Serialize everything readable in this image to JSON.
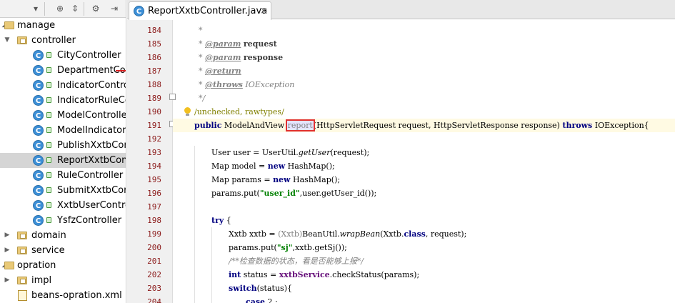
{
  "sidebar": {
    "tree": [
      {
        "label": "manage",
        "kind": "folder",
        "expanded": true
      },
      {
        "label": "controller",
        "kind": "package",
        "expanded": true
      },
      {
        "label": "CityController",
        "kind": "class"
      },
      {
        "label": "DepartmentCont",
        "kind": "class"
      },
      {
        "label": "IndicatorControl",
        "kind": "class"
      },
      {
        "label": "IndicatorRuleCor",
        "kind": "class"
      },
      {
        "label": "ModelController",
        "kind": "class"
      },
      {
        "label": "ModelIndicatorC",
        "kind": "class"
      },
      {
        "label": "PublishXxtbContr",
        "kind": "class"
      },
      {
        "label": "ReportXxtbContr",
        "kind": "class",
        "selected": true
      },
      {
        "label": "RuleController",
        "kind": "class"
      },
      {
        "label": "SubmitXxtbContr",
        "kind": "class"
      },
      {
        "label": "XxtbUserControl",
        "kind": "class"
      },
      {
        "label": "YsfzController",
        "kind": "class"
      },
      {
        "label": "domain",
        "kind": "package",
        "expanded": false
      },
      {
        "label": "service",
        "kind": "package",
        "expanded": false
      },
      {
        "label": "opration",
        "kind": "folder",
        "expanded": true
      },
      {
        "label": "impl",
        "kind": "package",
        "expanded": false
      },
      {
        "label": "beans-opration.xml",
        "kind": "xml"
      }
    ]
  },
  "editor": {
    "tab_title": "ReportXxtbController.java",
    "tab_icon_letter": "C",
    "line_numbers": [
      "184",
      "185",
      "186",
      "187",
      "188",
      "189",
      "190",
      "191",
      "192",
      "193",
      "194",
      "195",
      "196",
      "197",
      "198",
      "199",
      "200",
      "201",
      "202",
      "203",
      "204"
    ],
    "tokens": {
      "l184_star": "*",
      "l185_star": "* ",
      "l185_tag": "@param",
      "l185_name": "request",
      "l186_star": "* ",
      "l186_tag": "@param",
      "l186_name": "response",
      "l187_star": "* ",
      "l187_tag": "@return",
      "l188_star": "* ",
      "l188_tag": "@throws",
      "l188_text": " IOException",
      "l189_end": "*/",
      "l190_ann": "/unchecked, rawtypes/",
      "l191_kw1": "public",
      "l191_a": " ModelAndView ",
      "l191_method": "report",
      "l191_b": "(HttpServletRequest request, HttpServletResponse response) ",
      "l191_kw2": "throws",
      "l191_c": " IOException{",
      "l193_a": "User user = UserUtil.",
      "l193_i": "getUser",
      "l193_b": "(request);",
      "l194_a": "Map model = ",
      "l194_kw": "new",
      "l194_b": " HashMap();",
      "l195_a": "Map params = ",
      "l195_kw": "new",
      "l195_b": " HashMap();",
      "l196_a": "params.put(",
      "l196_str": "\"user_id\"",
      "l196_b": ",user.getUser_id());",
      "l198_kw": "try",
      "l198_b": " {",
      "l199_a": "Xxtb xxtb = ",
      "l199_cast": "(Xxtb)",
      "l199_b": "BeanUtil.",
      "l199_i": "wrapBean",
      "l199_c": "(Xxtb.",
      "l199_kw": "class",
      "l199_d": ", request);",
      "l200_a": "params.put(",
      "l200_str": "\"sj\"",
      "l200_b": ",xxtb.getSj());",
      "l201_cmt": "/**检查数据的状态，看是否能够上报*/",
      "l202_kw": "int",
      "l202_a": " status = ",
      "l202_field": "xxtbService",
      "l202_b": ".checkStatus(params);",
      "l203_kw": "switch",
      "l203_b": "(status){",
      "l204_kw": "case",
      "l204_b": " 2 :"
    }
  }
}
